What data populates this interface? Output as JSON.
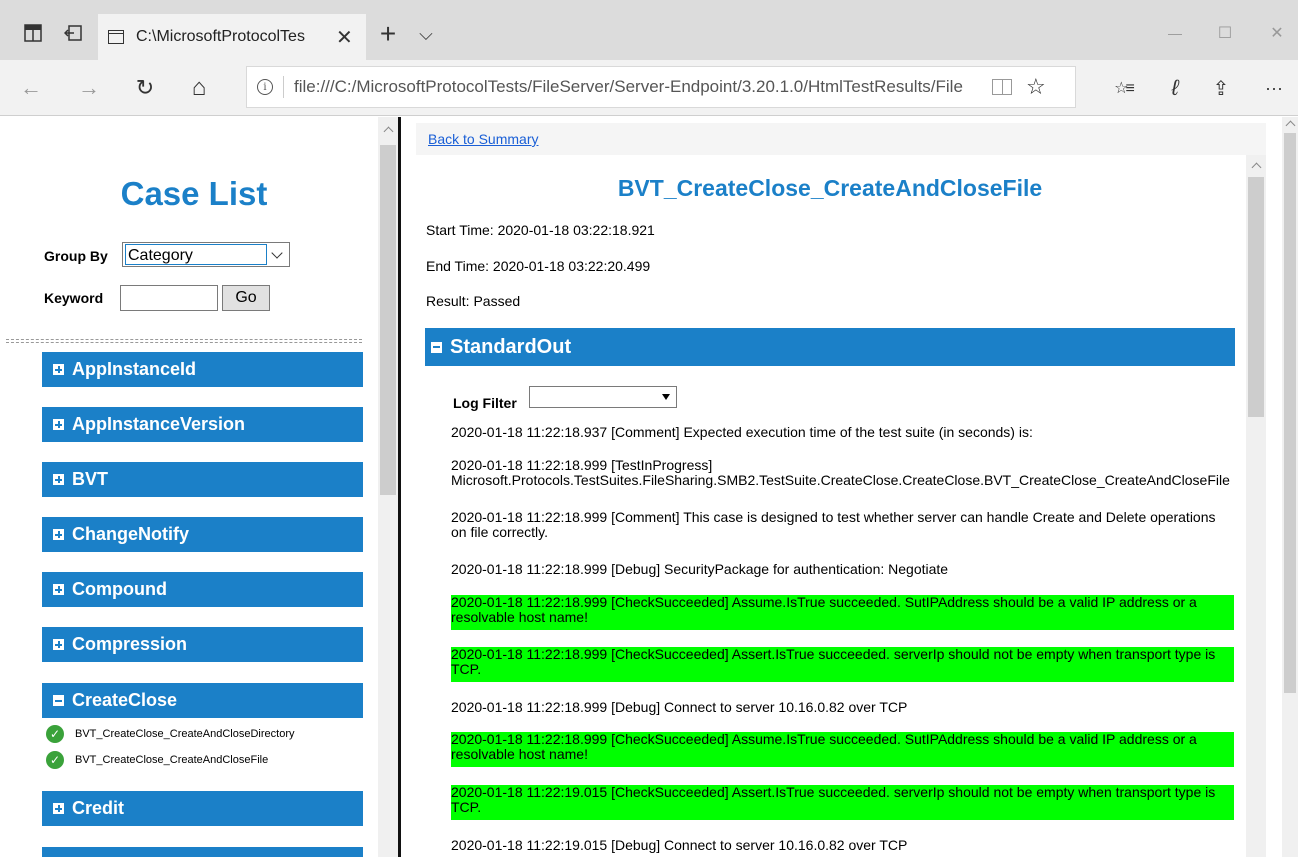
{
  "browser": {
    "tab_title": "C:\\MicrosoftProtocolTes",
    "tab_close": "✕",
    "new_tab": "+",
    "tab_menu": "⌵",
    "window_minimize": "—",
    "window_maximize": "☐",
    "window_close": "✕",
    "nav_back": "←",
    "nav_forward": "→",
    "nav_refresh": "↻",
    "nav_home": "⌂",
    "url": "file:///C:/MicrosoftProtocolTests/FileServer/Server-Endpoint/3.20.1.0/HtmlTestResults/File",
    "info_glyph": "i",
    "favorite_star": "☆",
    "favorites_list": "☆≡",
    "pen": "ℓ",
    "share": "⇪",
    "more": "···"
  },
  "left": {
    "title": "Case List",
    "group_by_label": "Group By",
    "group_by_value": "Category",
    "keyword_label": "Keyword",
    "keyword_value": "",
    "go_label": "Go",
    "categories": [
      {
        "label": "AppInstanceId",
        "expanded": false
      },
      {
        "label": "AppInstanceVersion",
        "expanded": false
      },
      {
        "label": "BVT",
        "expanded": false
      },
      {
        "label": "ChangeNotify",
        "expanded": false
      },
      {
        "label": "Compound",
        "expanded": false
      },
      {
        "label": "Compression",
        "expanded": false
      },
      {
        "label": "CreateClose",
        "expanded": true
      },
      {
        "label": "Credit",
        "expanded": false
      }
    ],
    "cases": [
      {
        "label": "BVT_CreateClose_CreateAndCloseDirectory",
        "status": "passed"
      },
      {
        "label": "BVT_CreateClose_CreateAndCloseFile",
        "status": "passed"
      }
    ],
    "check_glyph": "✓"
  },
  "right": {
    "back_link": "Back to Summary",
    "test_title": "BVT_CreateClose_CreateAndCloseFile",
    "start_time": "Start Time: 2020-01-18 03:22:18.921",
    "end_time": "End Time: 2020-01-18 03:22:20.499",
    "result": "Result: Passed",
    "section_title": "StandardOut",
    "log_filter_label": "Log Filter",
    "log_filter_value": "",
    "logs": [
      "2020-01-18 11:22:18.937 [Comment] Expected execution time of the test suite (in seconds) is:",
      "2020-01-18 11:22:18.999 [TestInProgress]",
      "Microsoft.Protocols.TestSuites.FileSharing.SMB2.TestSuite.CreateClose.CreateClose.BVT_CreateClose_CreateAndCloseFile",
      "2020-01-18 11:22:18.999 [Comment] This case is designed to test whether server can handle Create and Delete operations on file correctly.",
      "2020-01-18 11:22:18.999 [Debug] SecurityPackage for authentication: Negotiate",
      "2020-01-18 11:22:18.999 [CheckSucceeded] Assume.IsTrue succeeded. SutIPAddress should be a valid IP address or a resolvable host name!",
      "2020-01-18 11:22:18.999 [CheckSucceeded] Assert.IsTrue succeeded. serverIp should not be empty when transport type is TCP.",
      "2020-01-18 11:22:18.999 [Debug] Connect to server 10.16.0.82 over TCP",
      "2020-01-18 11:22:18.999 [CheckSucceeded] Assume.IsTrue succeeded. SutIPAddress should be a valid IP address or a resolvable host name!",
      "2020-01-18 11:22:19.015 [CheckSucceeded] Assert.IsTrue succeeded. serverIp should not be empty when transport type is TCP.",
      "2020-01-18 11:22:19.015 [Debug] Connect to server 10.16.0.82 over TCP"
    ]
  },
  "colors": {
    "accent": "#1b80c8",
    "success_highlight": "#00ff00",
    "link": "#1a5fd6"
  }
}
